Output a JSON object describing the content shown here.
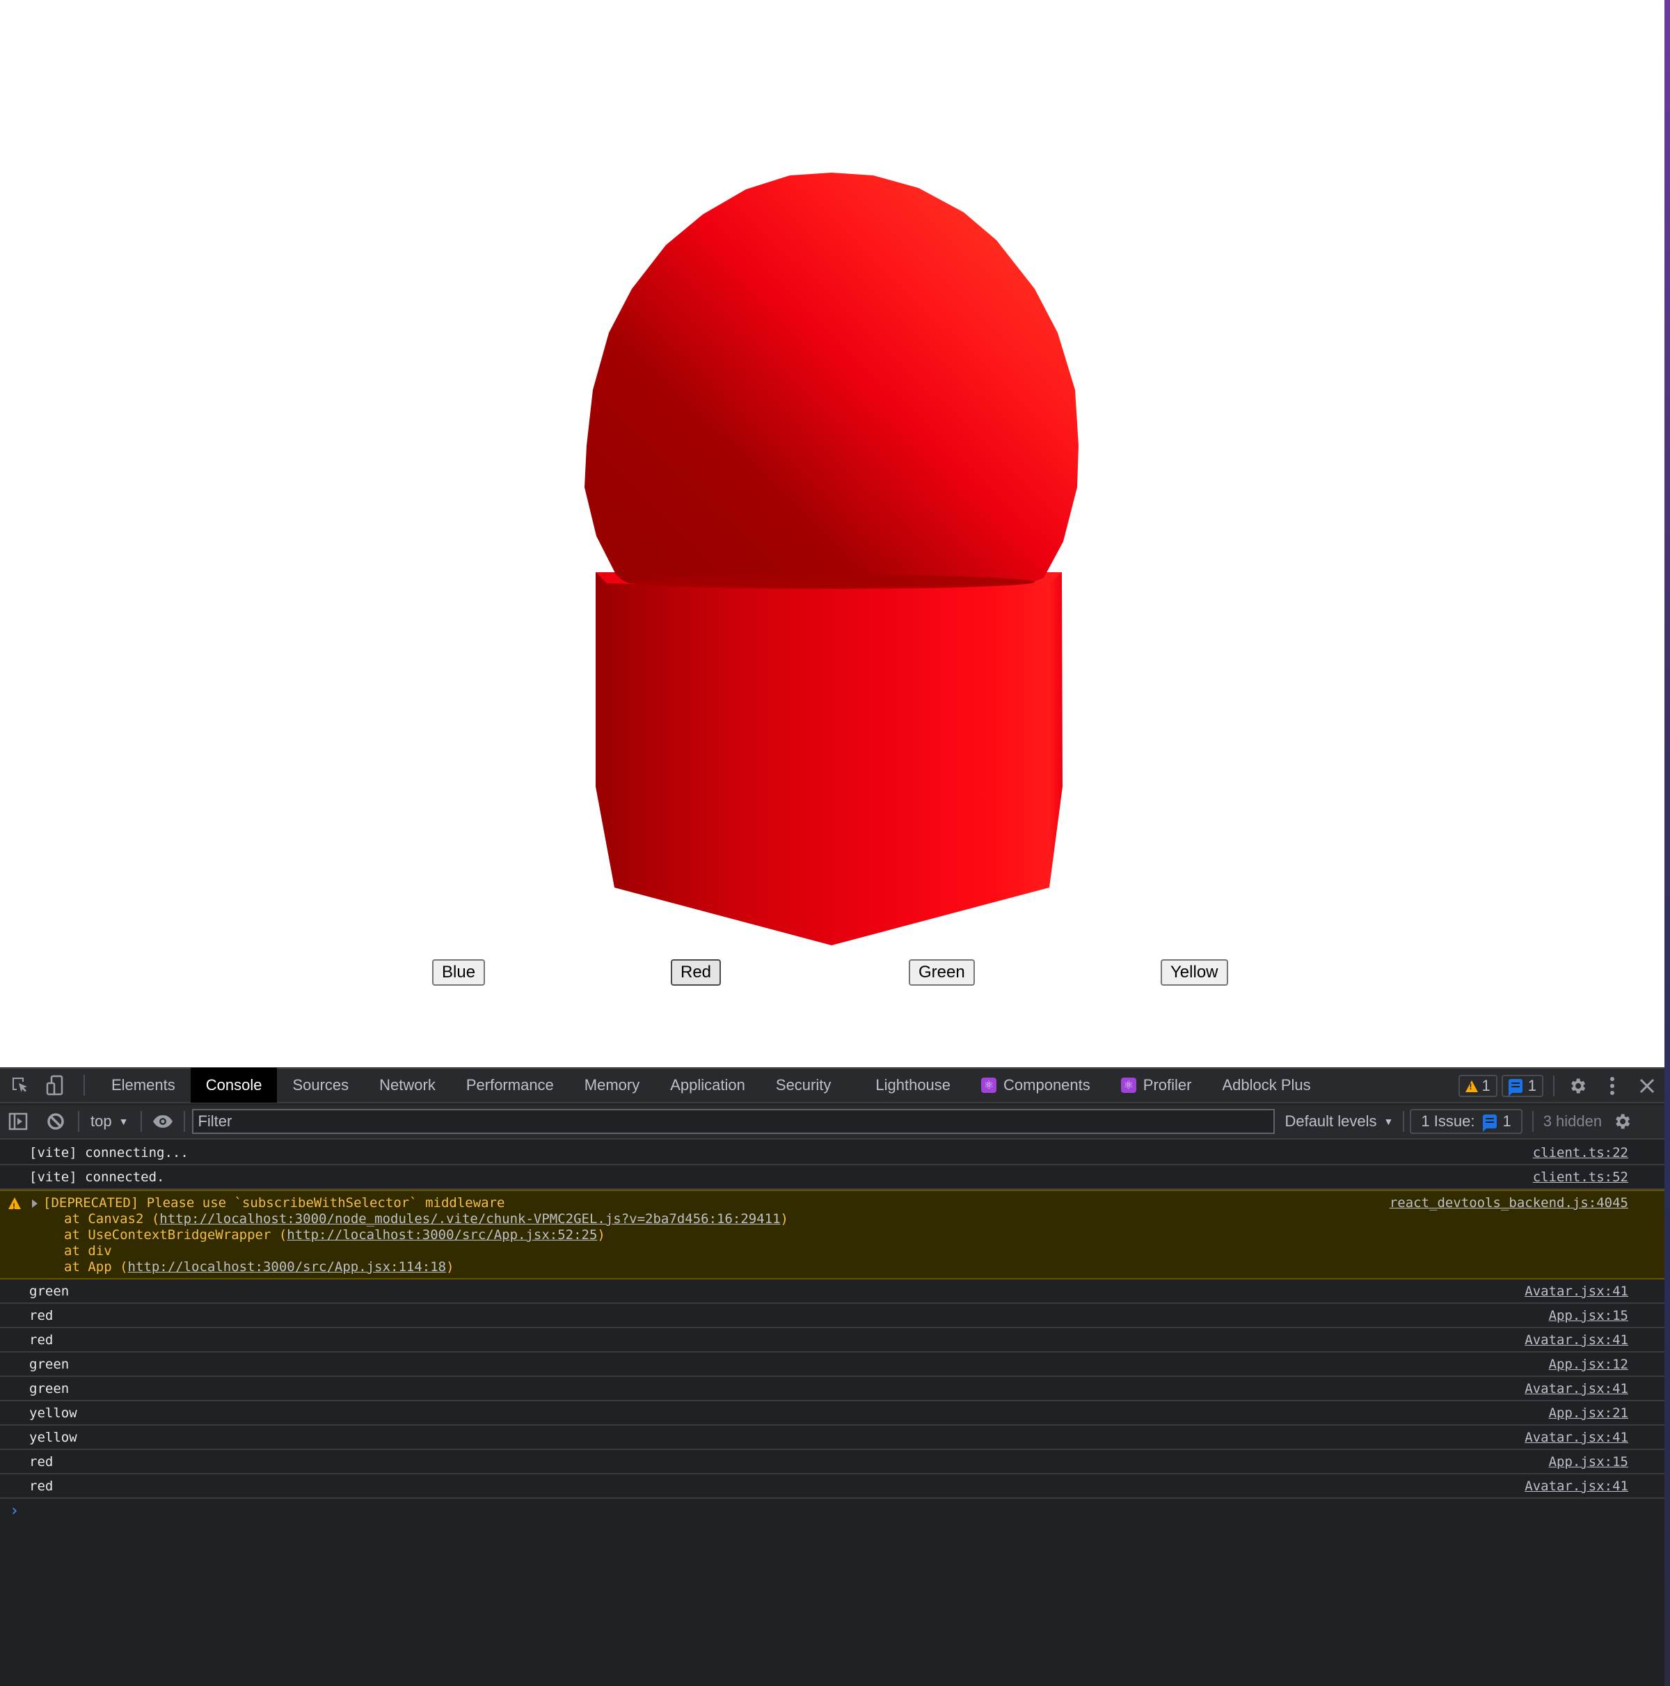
{
  "page": {
    "scene": {
      "description": "3D rendered avatar: sphere on top of a prism base",
      "object_color": "#ff0000",
      "shade_dark": "#990000",
      "shade_light": "#ff2a1a"
    },
    "buttons": [
      {
        "label": "Blue"
      },
      {
        "label": "Red"
      },
      {
        "label": "Green"
      },
      {
        "label": "Yellow"
      }
    ]
  },
  "devtools": {
    "tabs": [
      {
        "label": "Elements"
      },
      {
        "label": "Console"
      },
      {
        "label": "Sources"
      },
      {
        "label": "Network"
      },
      {
        "label": "Performance"
      },
      {
        "label": "Memory"
      },
      {
        "label": "Application"
      },
      {
        "label": "Security"
      },
      {
        "label": "Lighthouse"
      },
      {
        "label": "Components"
      },
      {
        "label": "Profiler"
      },
      {
        "label": "Adblock Plus"
      }
    ],
    "active_tab": "Console",
    "warning_count": "1",
    "message_count": "1",
    "toolbar": {
      "context": "top",
      "filter_placeholder": "Filter",
      "levels": "Default levels",
      "issues_label": "1 Issue:",
      "issues_count": "1",
      "hidden": "3 hidden"
    },
    "console": {
      "messages": [
        {
          "text": "[vite] connecting...",
          "source": "client.ts:22"
        },
        {
          "text": "[vite] connected.",
          "source": "client.ts:52"
        }
      ],
      "warning": {
        "text": "[DEPRECATED] Please use `subscribeWithSelector` middleware",
        "source": "react_devtools_backend.js:4045",
        "stack": [
          {
            "prefix": "at Canvas2 (",
            "link": "http://localhost:3000/node_modules/.vite/chunk-VPMC2GEL.js?v=2ba7d456:16:29411",
            "suffix": ")"
          },
          {
            "prefix": "at UseContextBridgeWrapper (",
            "link": "http://localhost:3000/src/App.jsx:52:25",
            "suffix": ")"
          },
          {
            "prefix": "at div",
            "link": "",
            "suffix": ""
          },
          {
            "prefix": "at App (",
            "link": "http://localhost:3000/src/App.jsx:114:18",
            "suffix": ")"
          }
        ]
      },
      "logs": [
        {
          "text": "green",
          "source": "Avatar.jsx:41"
        },
        {
          "text": "red",
          "source": "App.jsx:15"
        },
        {
          "text": "red",
          "source": "Avatar.jsx:41"
        },
        {
          "text": "green",
          "source": "App.jsx:12"
        },
        {
          "text": "green",
          "source": "Avatar.jsx:41"
        },
        {
          "text": "yellow",
          "source": "App.jsx:21"
        },
        {
          "text": "yellow",
          "source": "Avatar.jsx:41"
        },
        {
          "text": "red",
          "source": "App.jsx:15"
        },
        {
          "text": "red",
          "source": "Avatar.jsx:41"
        }
      ],
      "prompt_symbol": "›"
    }
  }
}
